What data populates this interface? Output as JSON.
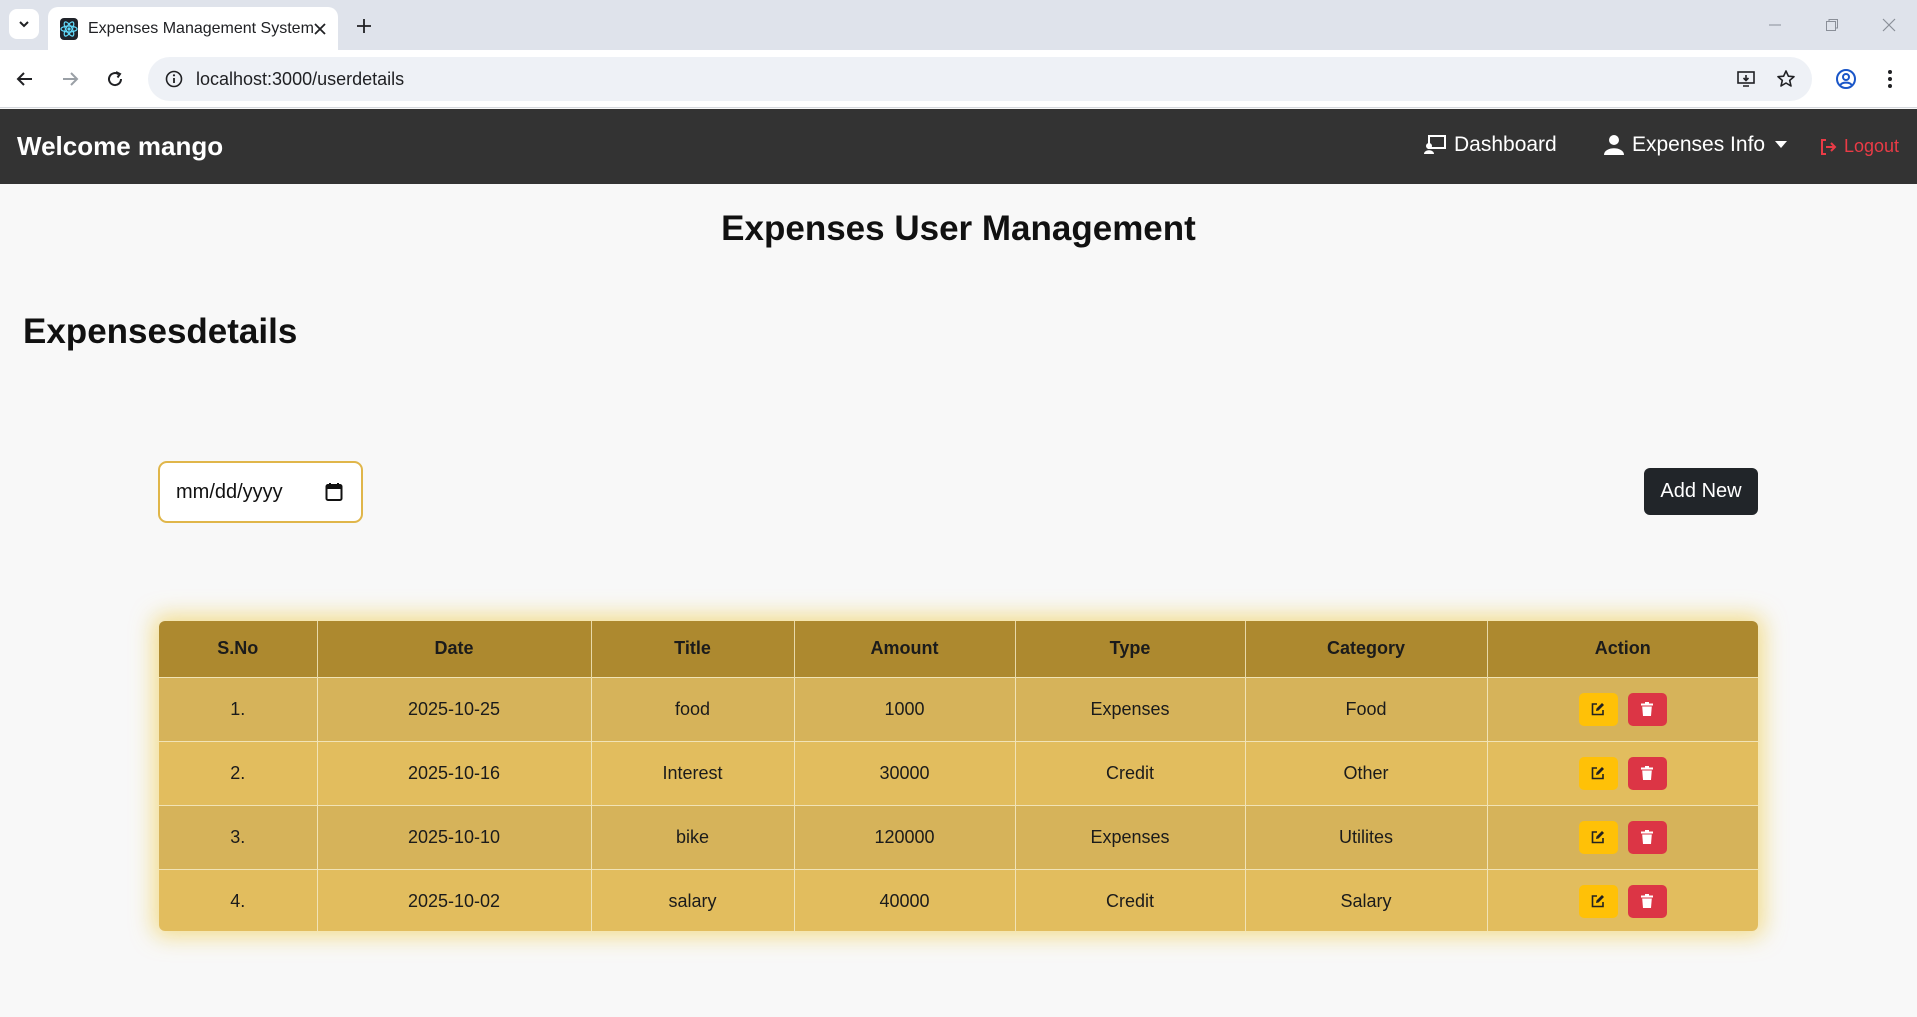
{
  "browser": {
    "tab_title": "Expenses Management System",
    "url": "localhost:3000/userdetails"
  },
  "navbar": {
    "brand": "Welcome mango",
    "dashboard_label": "Dashboard",
    "expenses_info_label": "Expenses Info",
    "logout_label": "Logout"
  },
  "page": {
    "title": "Expenses User Management",
    "section_title": "Expensesdetails",
    "date_placeholder": "mm/dd/yyyy",
    "add_new_label": "Add New"
  },
  "table": {
    "headers": [
      "S.No",
      "Date",
      "Title",
      "Amount",
      "Type",
      "Category",
      "Action"
    ],
    "rows": [
      {
        "sno": "1.",
        "date": "2025-10-25",
        "title": "food",
        "amount": "1000",
        "type": "Expenses",
        "category": "Food"
      },
      {
        "sno": "2.",
        "date": "2025-10-16",
        "title": "Interest",
        "amount": "30000",
        "type": "Credit",
        "category": "Other"
      },
      {
        "sno": "3.",
        "date": "2025-10-10",
        "title": "bike",
        "amount": "120000",
        "type": "Expenses",
        "category": "Utilites"
      },
      {
        "sno": "4.",
        "date": "2025-10-02",
        "title": "salary",
        "amount": "40000",
        "type": "Credit",
        "category": "Salary"
      }
    ]
  },
  "colors": {
    "navbar_bg": "#333333",
    "header_bg": "#ad892f",
    "row_odd": "#d6b35a",
    "row_even": "#e2bd5e",
    "edit_button": "#ffc107",
    "delete_button": "#dc3545",
    "logout": "#ea3b46"
  },
  "icons": {
    "dashboard": "dashboard-icon",
    "expenses_info": "user-icon",
    "logout": "sign-out-icon",
    "calendar": "calendar-icon",
    "edit": "edit-icon",
    "delete": "trash-icon"
  }
}
